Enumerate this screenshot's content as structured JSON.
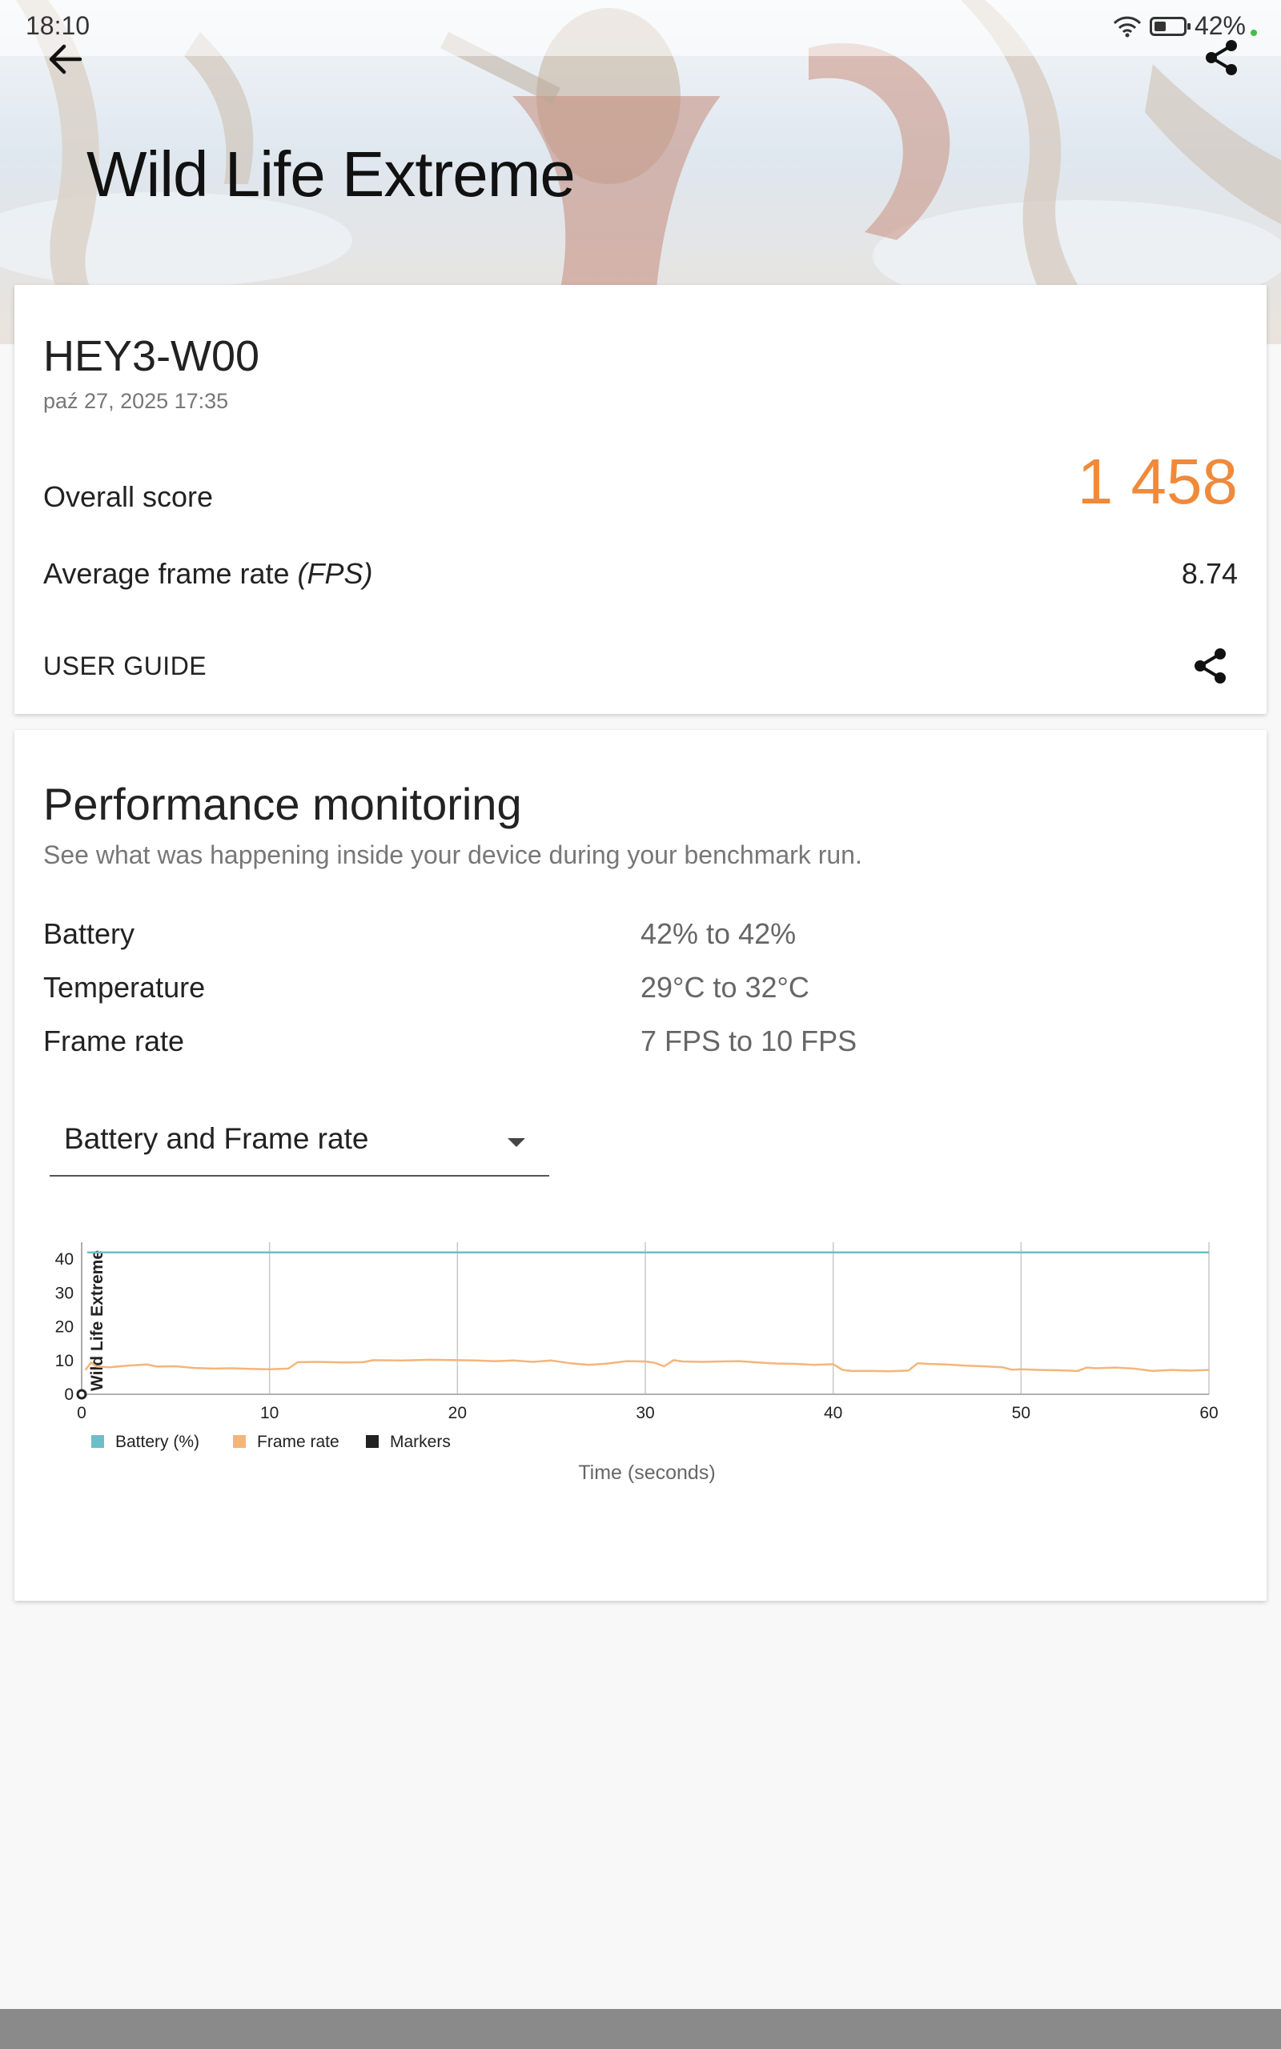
{
  "status_bar": {
    "time": "18:10",
    "battery_text": "42%"
  },
  "header": {
    "title": "Wild Life Extreme"
  },
  "result": {
    "device": "HEY3-W00",
    "date": "paź 27, 2025 17:35",
    "overall_label": "Overall score",
    "overall_value": "1 458",
    "fps_label_prefix": "Average frame rate ",
    "fps_label_unit": "(FPS)",
    "fps_value": "8.74",
    "user_guide": "USER GUIDE"
  },
  "monitoring": {
    "title": "Performance monitoring",
    "subtitle": "See what was happening inside your device during your benchmark run.",
    "metrics": [
      {
        "label": "Battery",
        "value": "42% to 42%"
      },
      {
        "label": "Temperature",
        "value": "29°C to 32°C"
      },
      {
        "label": "Frame rate",
        "value": "7 FPS to 10 FPS"
      }
    ],
    "dropdown_selected": "Battery and Frame rate"
  },
  "chart_data": {
    "type": "line",
    "x_title": "Time (seconds)",
    "y_series_label": "Wild Life Extreme",
    "xlim": [
      0,
      60
    ],
    "ylim": [
      0,
      45
    ],
    "x_ticks": [
      0,
      10,
      20,
      30,
      40,
      50,
      60
    ],
    "y_ticks": [
      0,
      10,
      20,
      30,
      40
    ],
    "grid": "vertical",
    "legend_position": "bottom-left",
    "legend": [
      {
        "name": "Battery (%)",
        "color": "#6bbfc6"
      },
      {
        "name": "Frame rate",
        "color": "#f5b57a"
      },
      {
        "name": "Markers",
        "color": "#222222"
      }
    ],
    "series": [
      {
        "name": "Battery (%)",
        "color": "#6bbfc6",
        "x": [
          0.3,
          60
        ],
        "y": [
          42,
          42
        ]
      },
      {
        "name": "Frame rate",
        "color": "#f5b57a",
        "x": [
          0.2,
          0.5,
          0.8,
          1.5,
          2.5,
          3.5,
          4.0,
          5.0,
          6.0,
          7.0,
          8.0,
          9.0,
          10.0,
          11.0,
          11.5,
          12.5,
          14.0,
          15.0,
          15.5,
          17.0,
          18.5,
          20.0,
          21.0,
          22.0,
          23.0,
          24.0,
          25.0,
          26.0,
          27.0,
          28.0,
          29.0,
          30.0,
          30.5,
          31.0,
          31.5,
          32.0,
          33.0,
          34.0,
          35.0,
          36.0,
          37.0,
          38.0,
          39.0,
          40.0,
          40.5,
          41.0,
          42.0,
          43.0,
          44.0,
          44.5,
          45.0,
          46.0,
          47.0,
          48.0,
          49.0,
          49.5,
          50.0,
          51.0,
          52.0,
          53.0,
          53.5,
          54.0,
          55.0,
          56.0,
          57.0,
          58.0,
          59.0,
          60.0
        ],
        "y": [
          7.2,
          9.4,
          8.2,
          8.0,
          8.5,
          8.8,
          8.2,
          8.3,
          7.8,
          7.6,
          7.7,
          7.5,
          7.4,
          7.6,
          9.5,
          9.6,
          9.4,
          9.5,
          10.1,
          10.0,
          10.2,
          10.1,
          10.0,
          9.8,
          10.0,
          9.6,
          10.0,
          9.2,
          8.7,
          9.1,
          9.8,
          9.7,
          9.3,
          8.3,
          10.1,
          9.7,
          9.6,
          9.7,
          9.8,
          9.4,
          9.1,
          9.0,
          8.7,
          8.9,
          7.2,
          6.9,
          6.9,
          6.8,
          7.0,
          9.2,
          9.0,
          8.8,
          8.5,
          8.3,
          8.0,
          7.3,
          7.4,
          7.2,
          7.1,
          6.9,
          7.9,
          7.7,
          7.9,
          7.6,
          6.9,
          7.2,
          7.0,
          7.2
        ]
      }
    ]
  }
}
